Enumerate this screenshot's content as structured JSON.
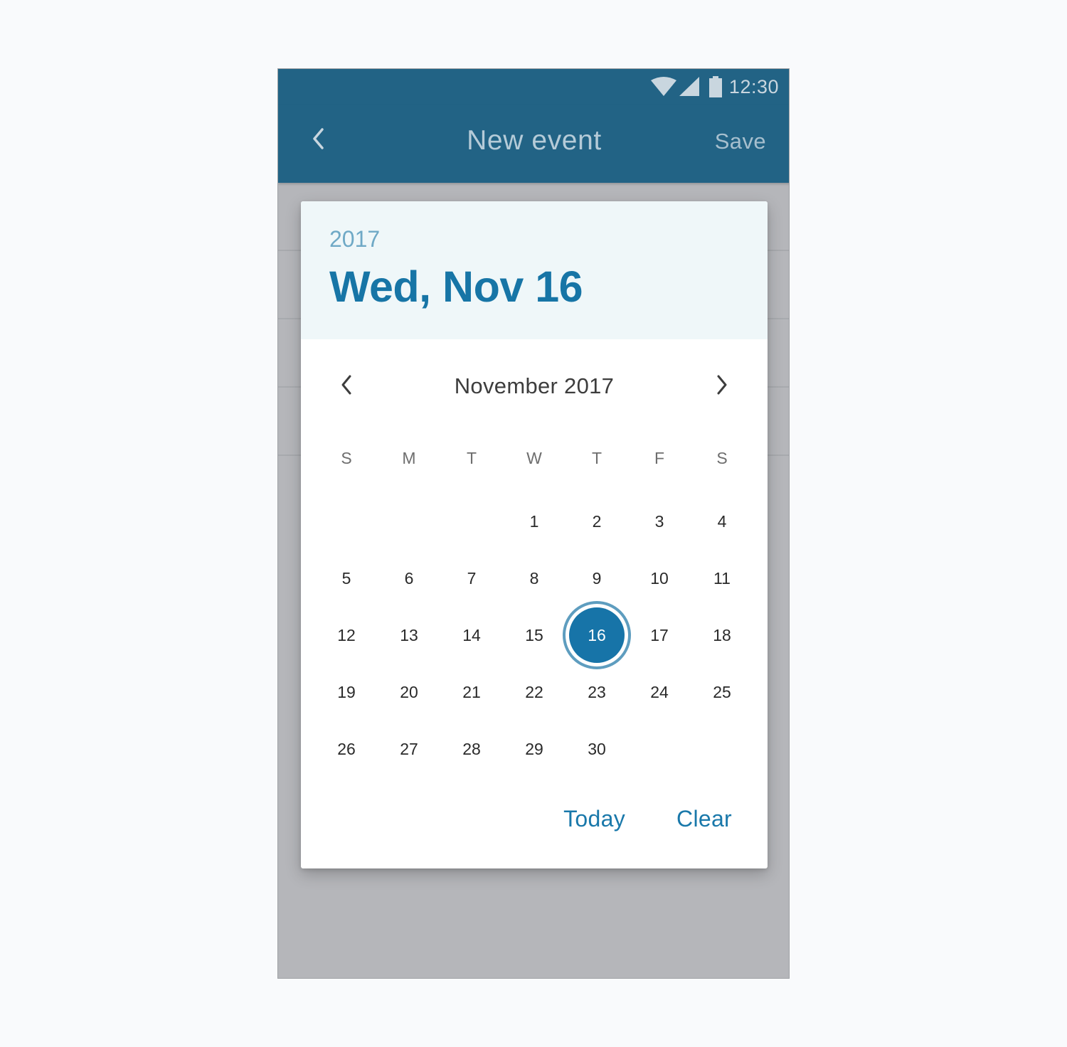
{
  "status_bar": {
    "time": "12:30",
    "icons": [
      "wifi-icon",
      "signal-icon",
      "battery-icon"
    ]
  },
  "app_bar": {
    "back_icon": "chevron-left-icon",
    "title": "New event",
    "save_label": "Save"
  },
  "date_picker": {
    "header": {
      "year": "2017",
      "selected_date": "Wed, Nov 16"
    },
    "month_label": "November 2017",
    "prev_icon": "chevron-left-icon",
    "next_icon": "chevron-right-icon",
    "weekdays": [
      "S",
      "M",
      "T",
      "W",
      "T",
      "F",
      "S"
    ],
    "leading_blank_days": 3,
    "days": [
      "1",
      "2",
      "3",
      "4",
      "5",
      "6",
      "7",
      "8",
      "9",
      "10",
      "11",
      "12",
      "13",
      "14",
      "15",
      "16",
      "17",
      "18",
      "19",
      "20",
      "21",
      "22",
      "23",
      "24",
      "25",
      "26",
      "27",
      "28",
      "29",
      "30"
    ],
    "selected_day": "16",
    "actions": {
      "today_label": "Today",
      "clear_label": "Clear"
    }
  },
  "colors": {
    "app_bar": "#226385",
    "accent": "#1775a6",
    "header_bg": "#eff7f9",
    "scrim": "#b5b6ba",
    "selected_ring": "#5e9dbf"
  }
}
